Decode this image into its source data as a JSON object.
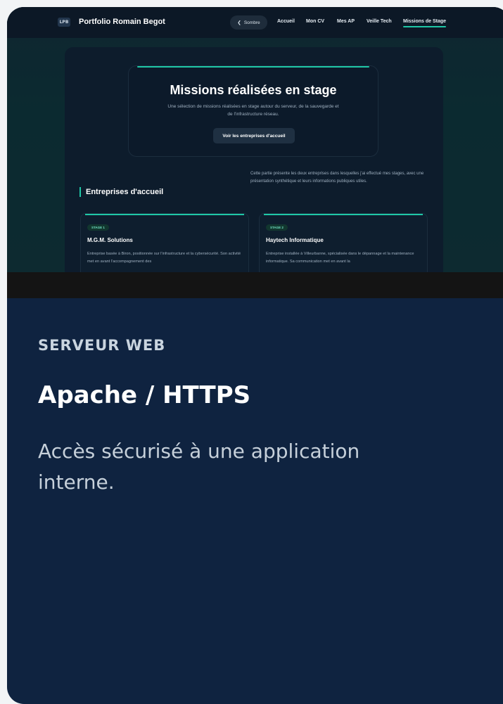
{
  "preview": {
    "brand": {
      "logo_text": "LPB",
      "name": "Portfolio Romain Begot"
    },
    "theme_toggle": {
      "icon": "chevron-left-icon",
      "label": "Sombre"
    },
    "nav": [
      "Accueil",
      "Mon CV",
      "Mes AP",
      "Veille Tech",
      "Missions de Stage"
    ],
    "active_nav": "Missions de Stage",
    "hero": {
      "title": "Missions réalisées en stage",
      "subtitle": "Une sélection de missions réalisées en stage autour du serveur, de la sauvegarde et de l'infrastructure réseau.",
      "button": "Voir les entreprises d'accueil"
    },
    "section": {
      "title": "Entreprises d'accueil",
      "description": "Cette partie présente les deux entreprises dans lesquelles j'ai effectué mes stages, avec une présentation synthétique et leurs informations publiques utiles."
    },
    "companies": [
      {
        "badge": "STAGE 1",
        "name": "M.G.M. Solutions",
        "description": "Entreprise basée à Biron, positionnée sur l'infrastructure et la cybersécurité. Son activité met en avant l'accompagnement des"
      },
      {
        "badge": "STAGE 2",
        "name": "Haytech Informatique",
        "description": "Entreprise installée à Villeurbanne, spécialisée dans le dépannage et la maintenance informatique. Sa communication met en avant la"
      }
    ]
  },
  "card": {
    "kicker": "SERVEUR WEB",
    "title": "Apache / HTTPS",
    "description": "Accès sécurisé à une application interne."
  },
  "colors": {
    "accent": "#1fc7a6",
    "card_background": "#0f2340",
    "page_background": "#f2f4f6"
  }
}
